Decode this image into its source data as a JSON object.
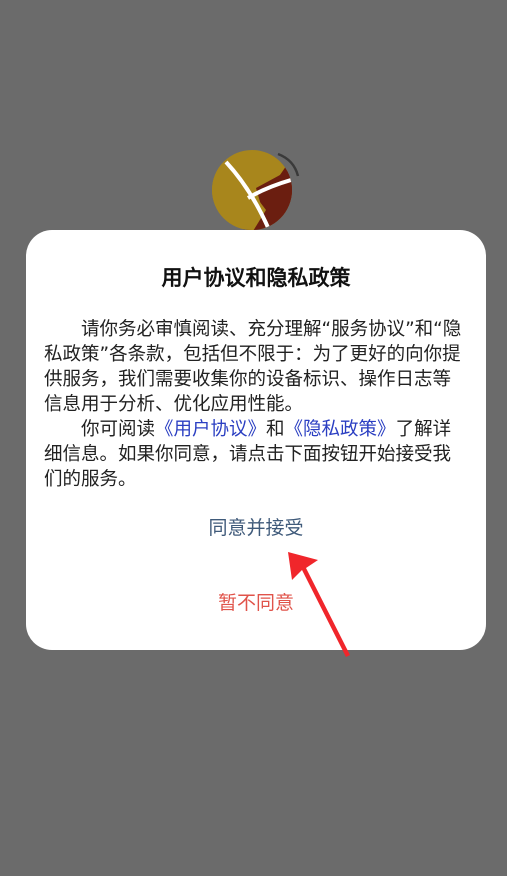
{
  "dialog": {
    "title": "用户协议和隐私政策",
    "paragraph1": "请你务必审慎阅读、充分理解“服务协议”和“隐私政策”各条款，包括但不限于：为了更好的向你提供服务，我们需要收集你的设备标识、操作日志等信息用于分析、优化应用性能。",
    "paragraph2_prefix": "你可阅读",
    "user_agreement_link": "《用户协议》",
    "paragraph2_and": "和",
    "privacy_policy_link": "《隐私政策》",
    "paragraph2_suffix": "了解详细信息。如果你同意，请点击下面按钮开始接受我们的服务。",
    "agree_label": "同意并接受",
    "decline_label": "暂不同意"
  },
  "colors": {
    "overlay": "#6b6b6b",
    "link": "#2b3fc2",
    "agree_text": "#3f5a7a",
    "decline_text": "#e0534a",
    "arrow": "#f0262b",
    "logo_gold": "#a8861c",
    "logo_dark_red": "#6b1e10"
  },
  "icons": {
    "logo": "app-logo-icon",
    "annotation": "red-pointer-arrow-icon"
  }
}
